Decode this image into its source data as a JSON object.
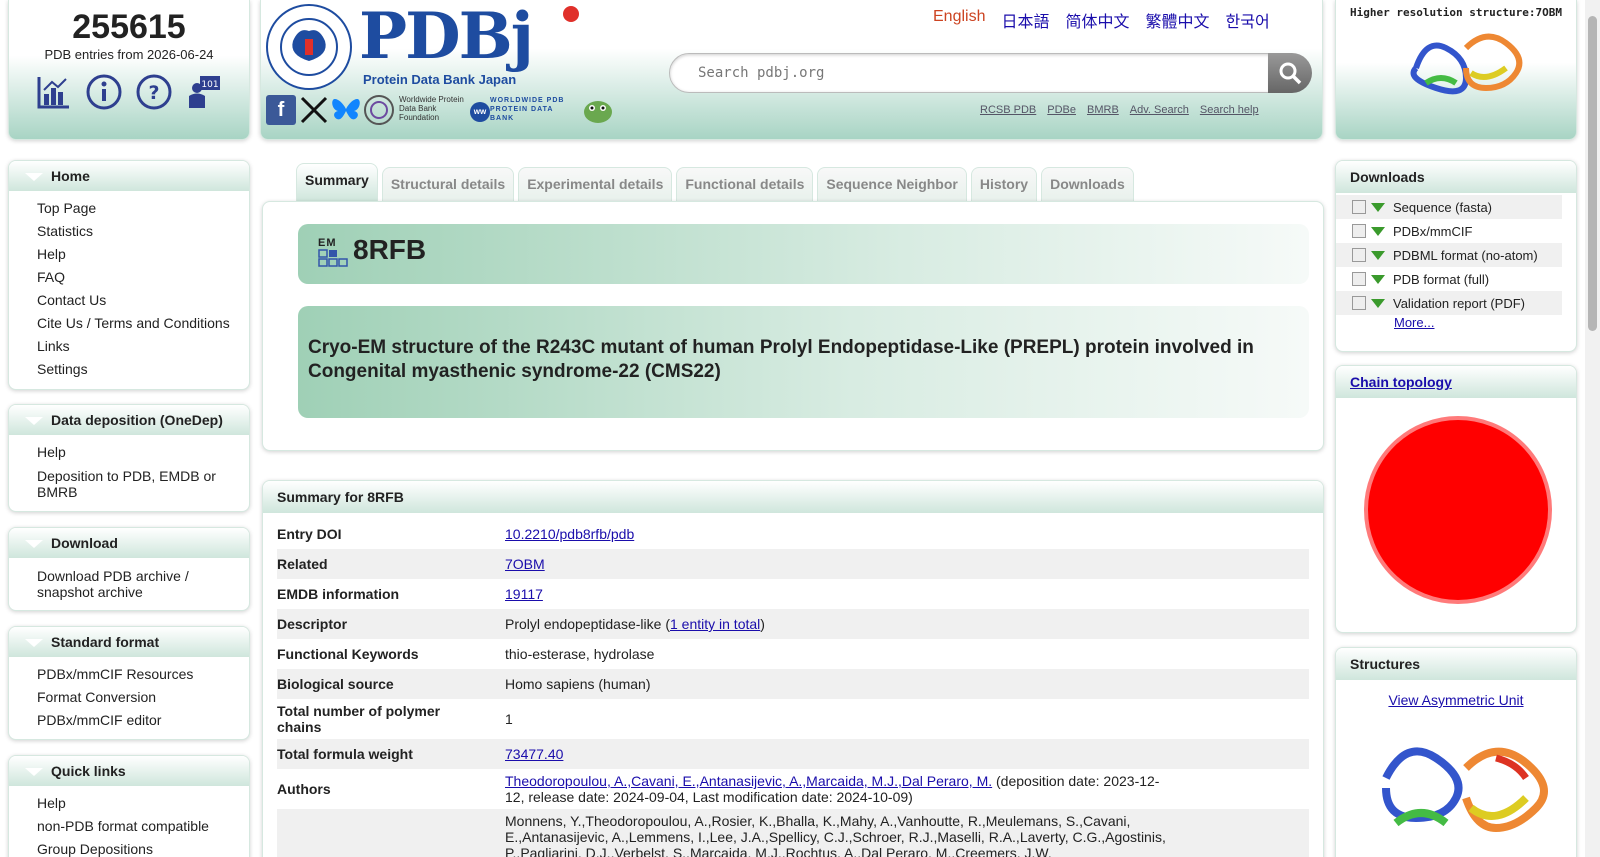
{
  "stats": {
    "count": "255615",
    "subtitle": "PDB entries from 2026-06-24",
    "icons": [
      "statistics-icon",
      "info-icon",
      "help-icon",
      "tutorial-icon"
    ]
  },
  "header": {
    "logo_text": "PDBj",
    "logo_subtitle": "Protein Data Bank Japan",
    "languages": [
      "English",
      "日本語",
      "简体中文",
      "繁體中文",
      "한국어"
    ],
    "active_language": "English",
    "search_placeholder": "Search pdbj.org",
    "search_links": [
      "RCSB PDB",
      "PDBe",
      "BMRB",
      "Adv. Search",
      "Search help"
    ],
    "wwpdb_foundation": "Worldwide Protein Data Bank Foundation",
    "wwpdb_label": "WORLDWIDE PDB PROTEIN DATA BANK"
  },
  "hires": {
    "title": "Higher resolution structure:7OBM"
  },
  "nav": [
    {
      "title": "Home",
      "items": [
        "Top Page",
        "Statistics",
        "Help",
        "FAQ",
        "Contact Us",
        "Cite Us / Terms and Conditions",
        "Links",
        "Settings"
      ]
    },
    {
      "title": "Data deposition (OneDep)",
      "items": [
        "Help",
        "Deposition to PDB, EMDB or BMRB"
      ]
    },
    {
      "title": "Download",
      "items": [
        "Download PDB archive / snapshot archive"
      ]
    },
    {
      "title": "Standard format",
      "items": [
        "PDBx/mmCIF Resources",
        "Format Conversion",
        "PDBx/mmCIF editor"
      ]
    },
    {
      "title": "Quick links",
      "items": [
        "Help",
        "non-PDB format compatible",
        "Group Depositions"
      ]
    }
  ],
  "tabs": [
    "Summary",
    "Structural details",
    "Experimental details",
    "Functional details",
    "Sequence Neighbor",
    "History",
    "Downloads"
  ],
  "active_tab": "Summary",
  "entry": {
    "method_badge": "EM",
    "id": "8RFB",
    "title": "Cryo-EM structure of the R243C mutant of human Prolyl Endopeptidase-Like (PREPL) protein involved in Congenital myasthenic syndrome-22 (CMS22)"
  },
  "summary": {
    "heading": "Summary for 8RFB",
    "rows": {
      "doi": {
        "label": "Entry DOI",
        "value": "10.2210/pdb8rfb/pdb"
      },
      "related": {
        "label": "Related",
        "value": "7OBM"
      },
      "emdb": {
        "label": "EMDB information",
        "value": "19117"
      },
      "descriptor": {
        "label": "Descriptor",
        "value": "Prolyl endopeptidase-like (",
        "link": "1 entity in total",
        "suffix": ")"
      },
      "keywords": {
        "label": "Functional Keywords",
        "value": "thio-esterase, hydrolase"
      },
      "source": {
        "label": "Biological source",
        "value": "Homo sapiens (human)"
      },
      "chains": {
        "label": "Total number of polymer chains",
        "value": "1"
      },
      "weight": {
        "label": "Total formula weight",
        "value": "73477.40"
      },
      "authors": {
        "label": "Authors",
        "value": "Theodoropoulou, A.,Cavani, E.,Antanasijevic, A.,Marcaida, M.J.,Dal Peraro, M.",
        "suffix": " (deposition date: 2023-12-12, release date: 2024-09-04, Last modification date: 2024-10-09)"
      },
      "citation": {
        "label": "",
        "value": "Monnens, Y.,Theodoropoulou, A.,Rosier, K.,Bhalla, K.,Mahy, A.,Vanhoutte, R.,Meulemans, S.,Cavani, E.,Antanasijevic, A.,Lemmens, I.,Lee, J.A.,Spellicy, C.J.,Schroer, R.J.,Maselli, R.A.,Laverty, C.G.,Agostinis, P.,Pagliarini, D.J.,Verbelst, S.,Marcaida, M.J.,Rochtus, A.,Dal Peraro, M.,Creemers, J.W."
      }
    }
  },
  "downloads": {
    "heading": "Downloads",
    "items": [
      "Sequence (fasta)",
      "PDBx/mmCIF",
      "PDBML format (no-atom)",
      "PDB format (full)",
      "Validation report (PDF)"
    ],
    "more": "More..."
  },
  "chain_topology": {
    "heading": "Chain topology"
  },
  "structures": {
    "heading": "Structures",
    "link": "View Asymmetric Unit"
  },
  "colors": {
    "accent": "#a8d4c4",
    "link": "#1a0dab",
    "active_lang": "#cc4422",
    "topology": "#ff0000"
  }
}
